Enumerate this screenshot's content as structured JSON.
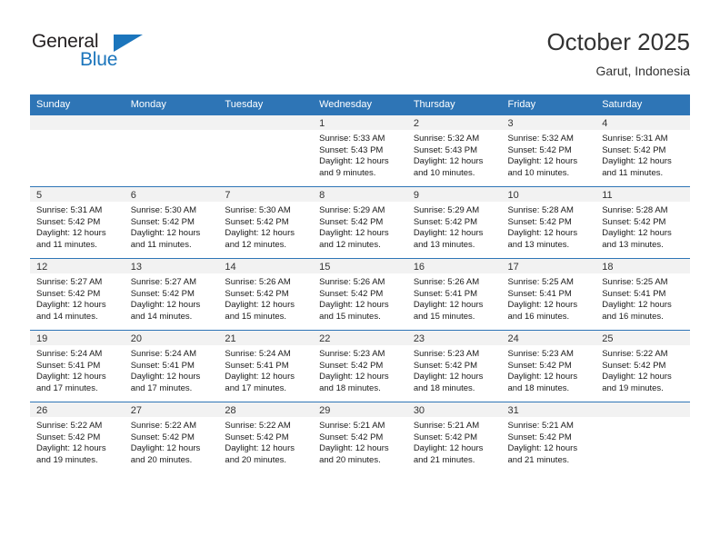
{
  "brand": {
    "name_top": "General",
    "name_bottom": "Blue",
    "triangle_icon": "triangle-icon",
    "color_dark": "#231f20",
    "color_blue": "#1b75bc"
  },
  "header": {
    "title": "October 2025",
    "subtitle": "Garut, Indonesia"
  },
  "theme": {
    "header_bg": "#2e75b6",
    "daynum_bg": "#f2f2f2",
    "cell_bg": "#ffffff",
    "text": "#1a1a1a"
  },
  "weekdays": [
    "Sunday",
    "Monday",
    "Tuesday",
    "Wednesday",
    "Thursday",
    "Friday",
    "Saturday"
  ],
  "weeks": [
    [
      {
        "day": "",
        "lines": []
      },
      {
        "day": "",
        "lines": []
      },
      {
        "day": "",
        "lines": []
      },
      {
        "day": "1",
        "lines": [
          "Sunrise: 5:33 AM",
          "Sunset: 5:43 PM",
          "Daylight: 12 hours",
          "and 9 minutes."
        ]
      },
      {
        "day": "2",
        "lines": [
          "Sunrise: 5:32 AM",
          "Sunset: 5:43 PM",
          "Daylight: 12 hours",
          "and 10 minutes."
        ]
      },
      {
        "day": "3",
        "lines": [
          "Sunrise: 5:32 AM",
          "Sunset: 5:42 PM",
          "Daylight: 12 hours",
          "and 10 minutes."
        ]
      },
      {
        "day": "4",
        "lines": [
          "Sunrise: 5:31 AM",
          "Sunset: 5:42 PM",
          "Daylight: 12 hours",
          "and 11 minutes."
        ]
      }
    ],
    [
      {
        "day": "5",
        "lines": [
          "Sunrise: 5:31 AM",
          "Sunset: 5:42 PM",
          "Daylight: 12 hours",
          "and 11 minutes."
        ]
      },
      {
        "day": "6",
        "lines": [
          "Sunrise: 5:30 AM",
          "Sunset: 5:42 PM",
          "Daylight: 12 hours",
          "and 11 minutes."
        ]
      },
      {
        "day": "7",
        "lines": [
          "Sunrise: 5:30 AM",
          "Sunset: 5:42 PM",
          "Daylight: 12 hours",
          "and 12 minutes."
        ]
      },
      {
        "day": "8",
        "lines": [
          "Sunrise: 5:29 AM",
          "Sunset: 5:42 PM",
          "Daylight: 12 hours",
          "and 12 minutes."
        ]
      },
      {
        "day": "9",
        "lines": [
          "Sunrise: 5:29 AM",
          "Sunset: 5:42 PM",
          "Daylight: 12 hours",
          "and 13 minutes."
        ]
      },
      {
        "day": "10",
        "lines": [
          "Sunrise: 5:28 AM",
          "Sunset: 5:42 PM",
          "Daylight: 12 hours",
          "and 13 minutes."
        ]
      },
      {
        "day": "11",
        "lines": [
          "Sunrise: 5:28 AM",
          "Sunset: 5:42 PM",
          "Daylight: 12 hours",
          "and 13 minutes."
        ]
      }
    ],
    [
      {
        "day": "12",
        "lines": [
          "Sunrise: 5:27 AM",
          "Sunset: 5:42 PM",
          "Daylight: 12 hours",
          "and 14 minutes."
        ]
      },
      {
        "day": "13",
        "lines": [
          "Sunrise: 5:27 AM",
          "Sunset: 5:42 PM",
          "Daylight: 12 hours",
          "and 14 minutes."
        ]
      },
      {
        "day": "14",
        "lines": [
          "Sunrise: 5:26 AM",
          "Sunset: 5:42 PM",
          "Daylight: 12 hours",
          "and 15 minutes."
        ]
      },
      {
        "day": "15",
        "lines": [
          "Sunrise: 5:26 AM",
          "Sunset: 5:42 PM",
          "Daylight: 12 hours",
          "and 15 minutes."
        ]
      },
      {
        "day": "16",
        "lines": [
          "Sunrise: 5:26 AM",
          "Sunset: 5:41 PM",
          "Daylight: 12 hours",
          "and 15 minutes."
        ]
      },
      {
        "day": "17",
        "lines": [
          "Sunrise: 5:25 AM",
          "Sunset: 5:41 PM",
          "Daylight: 12 hours",
          "and 16 minutes."
        ]
      },
      {
        "day": "18",
        "lines": [
          "Sunrise: 5:25 AM",
          "Sunset: 5:41 PM",
          "Daylight: 12 hours",
          "and 16 minutes."
        ]
      }
    ],
    [
      {
        "day": "19",
        "lines": [
          "Sunrise: 5:24 AM",
          "Sunset: 5:41 PM",
          "Daylight: 12 hours",
          "and 17 minutes."
        ]
      },
      {
        "day": "20",
        "lines": [
          "Sunrise: 5:24 AM",
          "Sunset: 5:41 PM",
          "Daylight: 12 hours",
          "and 17 minutes."
        ]
      },
      {
        "day": "21",
        "lines": [
          "Sunrise: 5:24 AM",
          "Sunset: 5:41 PM",
          "Daylight: 12 hours",
          "and 17 minutes."
        ]
      },
      {
        "day": "22",
        "lines": [
          "Sunrise: 5:23 AM",
          "Sunset: 5:42 PM",
          "Daylight: 12 hours",
          "and 18 minutes."
        ]
      },
      {
        "day": "23",
        "lines": [
          "Sunrise: 5:23 AM",
          "Sunset: 5:42 PM",
          "Daylight: 12 hours",
          "and 18 minutes."
        ]
      },
      {
        "day": "24",
        "lines": [
          "Sunrise: 5:23 AM",
          "Sunset: 5:42 PM",
          "Daylight: 12 hours",
          "and 18 minutes."
        ]
      },
      {
        "day": "25",
        "lines": [
          "Sunrise: 5:22 AM",
          "Sunset: 5:42 PM",
          "Daylight: 12 hours",
          "and 19 minutes."
        ]
      }
    ],
    [
      {
        "day": "26",
        "lines": [
          "Sunrise: 5:22 AM",
          "Sunset: 5:42 PM",
          "Daylight: 12 hours",
          "and 19 minutes."
        ]
      },
      {
        "day": "27",
        "lines": [
          "Sunrise: 5:22 AM",
          "Sunset: 5:42 PM",
          "Daylight: 12 hours",
          "and 20 minutes."
        ]
      },
      {
        "day": "28",
        "lines": [
          "Sunrise: 5:22 AM",
          "Sunset: 5:42 PM",
          "Daylight: 12 hours",
          "and 20 minutes."
        ]
      },
      {
        "day": "29",
        "lines": [
          "Sunrise: 5:21 AM",
          "Sunset: 5:42 PM",
          "Daylight: 12 hours",
          "and 20 minutes."
        ]
      },
      {
        "day": "30",
        "lines": [
          "Sunrise: 5:21 AM",
          "Sunset: 5:42 PM",
          "Daylight: 12 hours",
          "and 21 minutes."
        ]
      },
      {
        "day": "31",
        "lines": [
          "Sunrise: 5:21 AM",
          "Sunset: 5:42 PM",
          "Daylight: 12 hours",
          "and 21 minutes."
        ]
      },
      {
        "day": "",
        "lines": []
      }
    ]
  ]
}
